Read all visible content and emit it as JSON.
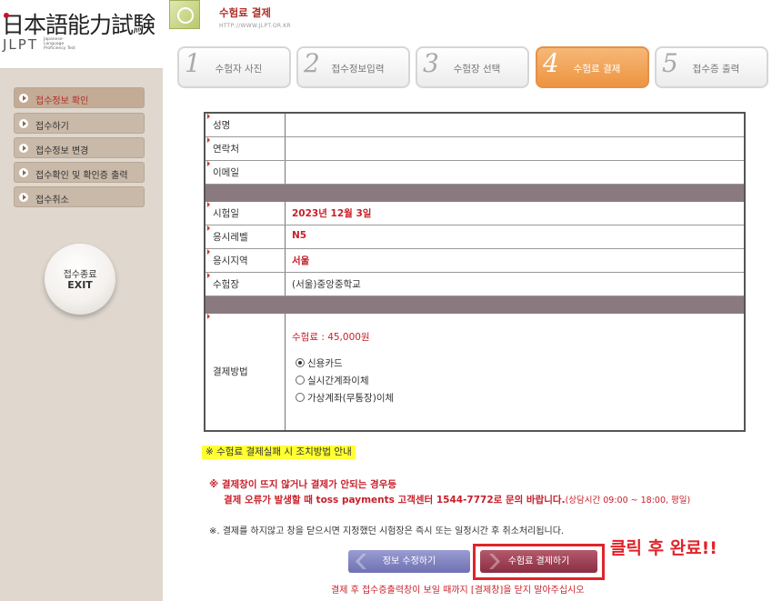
{
  "logo": {
    "kanji": "日本語能力試験",
    "latin": "JLPT",
    "sub": "Japanese-Language Proficiency Test"
  },
  "sidebar": {
    "items": [
      {
        "label": "접수정보 확인",
        "active": true
      },
      {
        "label": "접수하기",
        "active": false
      },
      {
        "label": "접수정보 변경",
        "active": false
      },
      {
        "label": "접수확인 및 확인증 출력",
        "active": false
      },
      {
        "label": "접수취소",
        "active": false
      }
    ],
    "exit": {
      "line1": "접수종료",
      "line2": "EXIT"
    }
  },
  "header": {
    "title": "수험료 결제",
    "url": "HTTP://WWW.JLPT.OR.KR"
  },
  "steps": [
    {
      "num": "1",
      "label": "수험자 사진",
      "active": false
    },
    {
      "num": "2",
      "label": "접수정보입력",
      "active": false
    },
    {
      "num": "3",
      "label": "수험장 선택",
      "active": false
    },
    {
      "num": "4",
      "label": "수험료 결제",
      "active": true
    },
    {
      "num": "5",
      "label": "접수증 출력",
      "active": false
    }
  ],
  "form": {
    "name_label": "성명",
    "phone_label": "연락처",
    "email_label": "이메일",
    "exam_date_label": "시험일",
    "exam_date": "2023년 12월 3일",
    "level_label": "응시레벨",
    "level": "N5",
    "region_label": "응시지역",
    "region": "서울",
    "venue_label": "수험장",
    "venue": "(서울)중앙중학교",
    "payment_label": "결제방법",
    "fee": "수험료 : 45,000원",
    "methods": [
      {
        "label": "신용카드",
        "selected": true
      },
      {
        "label": "실시간계좌이체",
        "selected": false
      },
      {
        "label": "가상계좌(무통장)이체",
        "selected": false
      }
    ]
  },
  "notice": {
    "title": "※ 수험료 결제실패 시 조치방법 안내",
    "line1": "※ 결제창이 뜨지 않거나 결제가 안되는 경우등",
    "line2": "결제 오류가 발생할 때 toss payments 고객센터 1544-7772로 문의 바랍니다.",
    "line2_hours": "(상담시간 09:00 ~ 18:00, 평일)",
    "line3": "※. 결제를 하지않고 창을 닫으시면 지정했던 시험장은 즉시 또는 일정시간 후 취소처리됩니다."
  },
  "buttons": {
    "edit": "정보 수정하기",
    "pay": "수험료 결제하기"
  },
  "annotation": "클릭 후 완료!!",
  "bottom_note": "결제 후 접수증출력창이 보일 때까지 [결제창]을 닫지 말아주십시오",
  "colors": {
    "accent_red": "#c8202a",
    "step_active": "#ed9440",
    "highlight_red": "#e0242a"
  }
}
